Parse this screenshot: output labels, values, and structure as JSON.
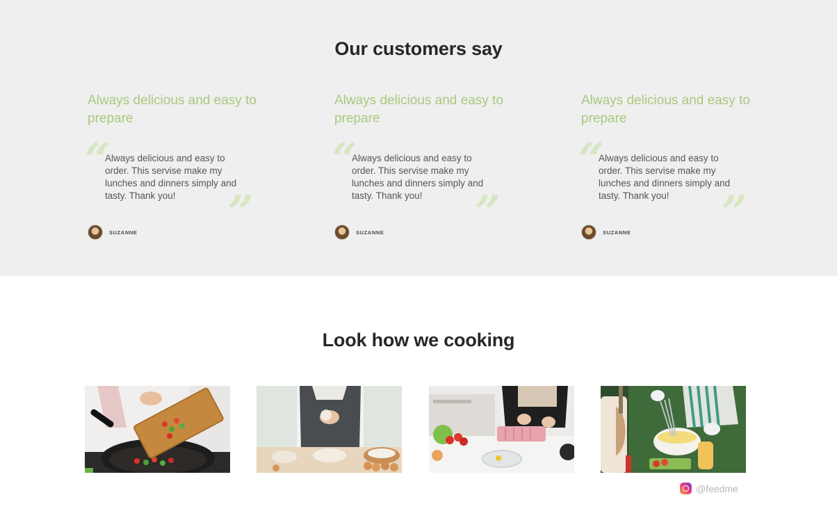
{
  "testimonials": {
    "title": "Our customers say",
    "cards": [
      {
        "title": "Always delicious and easy to prepare",
        "quote": "Always delicious and easy to order. This servise make my lunches and dinners simply and tasty. Thank you!",
        "author": "SUZANNE",
        "open_mark": "“",
        "close_mark": "”"
      },
      {
        "title": "Always delicious and easy to prepare",
        "quote": "Always delicious and easy to order. This servise make my lunches and dinners simply and tasty. Thank you!",
        "author": "SUZANNE",
        "open_mark": "“",
        "close_mark": "”"
      },
      {
        "title": "Always delicious and easy to prepare",
        "quote": "Always delicious and easy to order. This servise make my lunches and dinners simply and tasty. Thank you!",
        "author": "SUZANNE",
        "open_mark": "“",
        "close_mark": "”"
      }
    ]
  },
  "cooking": {
    "title": "Look how we cooking",
    "instagram_handle": "@feedme",
    "instagram_icon": "instagram-icon"
  },
  "colors": {
    "accent_green": "#a9c97f",
    "quote_mark": "#d7e6c2",
    "testimonial_bg": "#efefef"
  }
}
